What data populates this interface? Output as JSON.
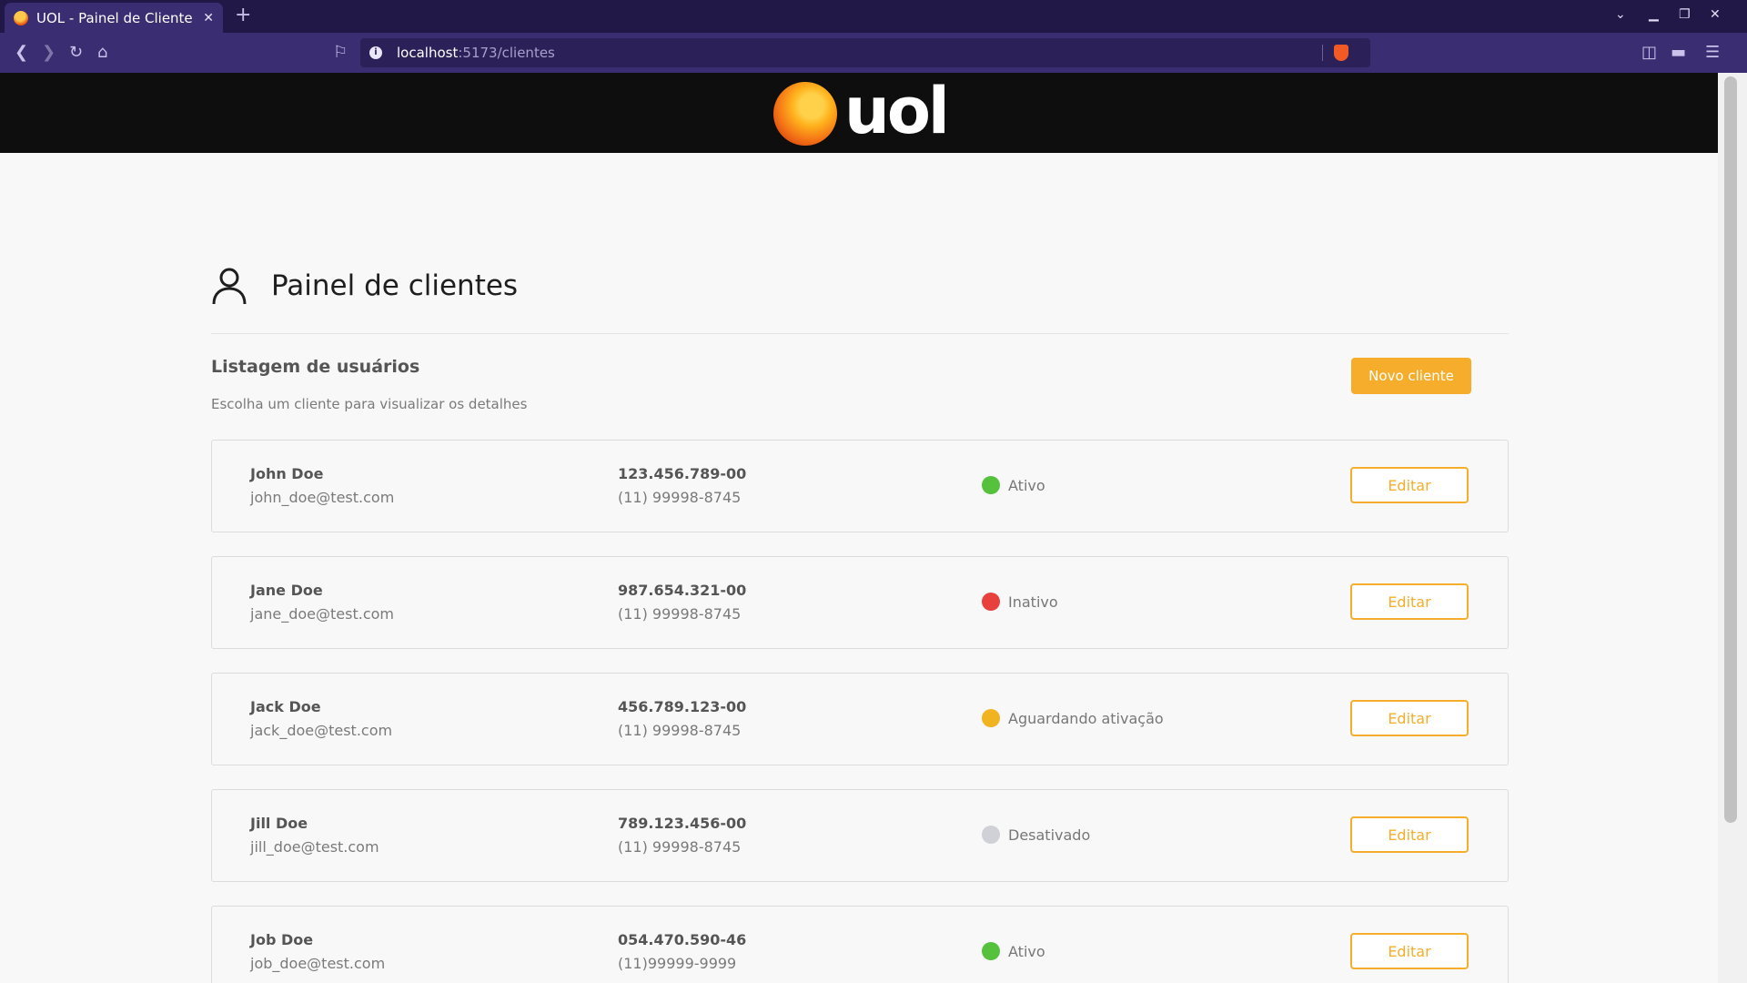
{
  "browser": {
    "tab_title": "UOL - Painel de Cliente",
    "url_host": "localhost",
    "url_path": ":5173/clientes"
  },
  "header": {
    "logo_text": "uol"
  },
  "panel": {
    "title": "Painel de clientes",
    "list_title": "Listagem de usuários",
    "list_subtitle": "Escolha um cliente para visualizar os detalhes",
    "new_client_label": "Novo cliente",
    "edit_label": "Editar"
  },
  "status_colors": {
    "Ativo": "#55c13d",
    "Inativo": "#e8403d",
    "Aguardando ativação": "#f2b321",
    "Desativado": "#cfd1d6"
  },
  "clients": [
    {
      "name": "John Doe",
      "email": "john_doe@test.com",
      "cpf": "123.456.789-00",
      "phone": "(11) 99998-8745",
      "status": "Ativo"
    },
    {
      "name": "Jane Doe",
      "email": "jane_doe@test.com",
      "cpf": "987.654.321-00",
      "phone": "(11) 99998-8745",
      "status": "Inativo"
    },
    {
      "name": "Jack Doe",
      "email": "jack_doe@test.com",
      "cpf": "456.789.123-00",
      "phone": "(11) 99998-8745",
      "status": "Aguardando ativação"
    },
    {
      "name": "Jill Doe",
      "email": "jill_doe@test.com",
      "cpf": "789.123.456-00",
      "phone": "(11) 99998-8745",
      "status": "Desativado"
    },
    {
      "name": "Job Doe",
      "email": "job_doe@test.com",
      "cpf": "054.470.590-46",
      "phone": "(11)99999-9999",
      "status": "Ativo"
    }
  ]
}
